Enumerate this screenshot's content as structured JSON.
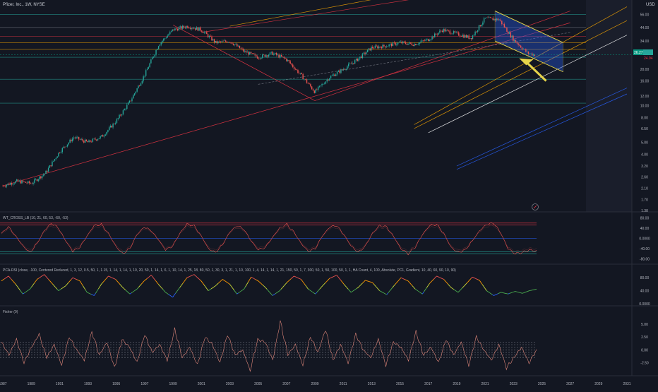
{
  "header": {
    "symbol": "Pfizer, Inc., 1W, NYSE"
  },
  "price_axis": {
    "currency": "USD",
    "ticks": [
      "56.00",
      "44.00",
      "34.00",
      "28.00",
      "20.00",
      "16.00",
      "12.00",
      "10.00",
      "8.00",
      "6.50",
      "5.00",
      "4.00",
      "3.20",
      "2.60",
      "2.10",
      "1.70",
      "1.38"
    ],
    "last_price": "26.27",
    "last_price_2": "24.94",
    "last_price_color": "#089981"
  },
  "time_axis": {
    "labels": [
      "1987",
      "1989",
      "1991",
      "1993",
      "1995",
      "1997",
      "1999",
      "2001",
      "2003",
      "2005",
      "2007",
      "2009",
      "2011",
      "2013",
      "2015",
      "2017",
      "2019",
      "2021",
      "2023",
      "2025",
      "2027",
      "2029",
      "2031"
    ]
  },
  "indicators": {
    "wt_cross": {
      "label": "WT_CROSS_LB (10, 21, 60, 53, -60, -53)",
      "ticks": [
        "80.00",
        "40.00",
        "0.0000",
        "-40.00",
        "-80.00"
      ]
    },
    "pca_rsi": {
      "label": "PCA-RSI (close, -100, Centered Reduced, 1, 3, 12, 0.5, 50, 1, 1.15, 1, 14, 1, 14, 1, 10, 20, 50, 1, 14, 1, 6, 1, 10, 14, 1, 25, 18, 80, 50, 1, 30, 3, 1, 21, 1, 10, 100, 1, 4, 14, 1, 14, 1, 21, 150, 50, 1, 7, 300, 50, 1, 50, 100, 50, 1, 1, HA Count, 4, 100, Absolute, PC1, Gradient, 10, 40, 60, 90, 10, 90)",
      "ticks": [
        "80.00",
        "40.00",
        "0.0000"
      ]
    },
    "fisher": {
      "label": "Fisher (9)",
      "ticks": [
        "5.00",
        "2.50",
        "0.00",
        "-2.50"
      ]
    }
  },
  "chart_data": [
    {
      "type": "candlestick",
      "title": "Pfizer, Inc., 1W, NYSE",
      "y_scale": "log",
      "ylim": [
        1.38,
        70
      ],
      "xlim": [
        1987,
        2031
      ],
      "price_series_yearly": [
        {
          "x": 1987,
          "y": 2.2
        },
        {
          "x": 1988,
          "y": 2.4
        },
        {
          "x": 1989,
          "y": 2.3
        },
        {
          "x": 1990,
          "y": 2.8
        },
        {
          "x": 1991,
          "y": 4.2
        },
        {
          "x": 1992,
          "y": 5.5
        },
        {
          "x": 1993,
          "y": 5.0
        },
        {
          "x": 1994,
          "y": 5.6
        },
        {
          "x": 1995,
          "y": 7.5
        },
        {
          "x": 1996,
          "y": 11
        },
        {
          "x": 1997,
          "y": 18
        },
        {
          "x": 1998,
          "y": 32
        },
        {
          "x": 1999,
          "y": 42
        },
        {
          "x": 2000,
          "y": 45
        },
        {
          "x": 2001,
          "y": 42
        },
        {
          "x": 2002,
          "y": 33
        },
        {
          "x": 2003,
          "y": 34
        },
        {
          "x": 2004,
          "y": 28
        },
        {
          "x": 2005,
          "y": 25
        },
        {
          "x": 2006,
          "y": 27
        },
        {
          "x": 2007,
          "y": 24
        },
        {
          "x": 2008,
          "y": 18
        },
        {
          "x": 2009,
          "y": 13
        },
        {
          "x": 2010,
          "y": 17
        },
        {
          "x": 2011,
          "y": 20
        },
        {
          "x": 2012,
          "y": 24
        },
        {
          "x": 2013,
          "y": 30
        },
        {
          "x": 2014,
          "y": 31
        },
        {
          "x": 2015,
          "y": 33
        },
        {
          "x": 2016,
          "y": 32
        },
        {
          "x": 2017,
          "y": 35
        },
        {
          "x": 2018,
          "y": 42
        },
        {
          "x": 2019,
          "y": 39
        },
        {
          "x": 2020,
          "y": 36
        },
        {
          "x": 2021,
          "y": 52
        },
        {
          "x": 2022,
          "y": 51
        },
        {
          "x": 2023,
          "y": 35
        },
        {
          "x": 2024,
          "y": 27
        },
        {
          "x": 2024.5,
          "y": 26.27
        }
      ],
      "horizontal_levels": [
        56,
        44,
        37,
        33,
        29,
        25,
        16.5,
        10.5
      ],
      "projection_channel": {
        "upper": [
          {
            "x": 2021.7,
            "y": 60
          },
          {
            "x": 2026.5,
            "y": 33
          }
        ],
        "lower": [
          {
            "x": 2021.7,
            "y": 34
          },
          {
            "x": 2026.5,
            "y": 19
          }
        ]
      }
    },
    {
      "type": "line",
      "title": "WT_CROSS_LB (10, 21, 60, 53, -60, -53)",
      "ylim": [
        -90,
        90
      ],
      "levels": [
        60,
        53,
        0,
        -53,
        -60
      ],
      "series": [
        {
          "values": [
            20,
            45,
            10,
            -30,
            -55,
            -20,
            30,
            60,
            40,
            -10,
            -50,
            -35,
            10,
            50,
            55,
            20,
            -30,
            -60,
            -40,
            15,
            45,
            30,
            -5,
            -45,
            -30,
            20,
            55,
            50,
            10,
            -40,
            -55,
            -25,
            25,
            50,
            35,
            -10,
            -45,
            -35,
            5,
            40,
            55,
            25,
            -20,
            -50,
            -40,
            10,
            45,
            50,
            15,
            -30,
            -55,
            -30,
            20,
            50,
            45,
            5,
            -40,
            -60,
            -35,
            15,
            50,
            55,
            20,
            -35,
            -55,
            -45,
            -10,
            30,
            55,
            60,
            20,
            -40,
            -60,
            -55,
            -45,
            -50
          ]
        }
      ]
    },
    {
      "type": "line",
      "title": "PCA-RSI",
      "ylim": [
        0,
        100
      ],
      "series": [
        {
          "values": [
            70,
            85,
            60,
            30,
            45,
            75,
            90,
            65,
            40,
            55,
            80,
            70,
            35,
            25,
            60,
            85,
            75,
            50,
            30,
            45,
            70,
            88,
            60,
            35,
            20,
            50,
            80,
            90,
            70,
            40,
            55,
            75,
            60,
            30,
            45,
            82,
            70,
            50,
            25,
            40,
            65,
            85,
            75,
            45,
            30,
            55,
            78,
            88,
            60,
            35,
            50,
            72,
            65,
            40,
            28,
            55,
            80,
            70,
            45,
            30,
            62,
            85,
            75,
            50,
            35,
            58,
            82,
            72,
            40,
            25,
            35,
            30,
            38,
            32,
            40,
            45
          ]
        }
      ]
    },
    {
      "type": "line",
      "title": "Fisher (9)",
      "ylim": [
        -4.5,
        6.5
      ],
      "levels": [
        1.5,
        1,
        0.5,
        0,
        -0.5,
        -1,
        -1.5
      ],
      "series": [
        {
          "values": [
            1.5,
            -1,
            2,
            -2.5,
            0.5,
            3,
            -1.5,
            1,
            -3,
            2.5,
            0,
            -2,
            3.5,
            -1,
            1.5,
            -3.5,
            2,
            0.5,
            -2.5,
            3,
            -0.5,
            1,
            -2,
            4,
            -1.5,
            0.5,
            -3,
            2.5,
            1,
            -2.5,
            3,
            -1,
            0,
            -4,
            2,
            1.5,
            -2,
            5.5,
            -1,
            1,
            -3,
            2.5,
            -0.5,
            4,
            -2,
            1,
            -2.5,
            3,
            0,
            -1.5,
            2,
            -3,
            1.5,
            0.5,
            -2,
            3.5,
            -1,
            0.5,
            -2.5,
            2,
            -1,
            1.5,
            -3,
            2.5,
            0,
            -2,
            1,
            -3.5,
            -1.5,
            0.5,
            -2.5,
            0
          ]
        }
      ]
    }
  ]
}
